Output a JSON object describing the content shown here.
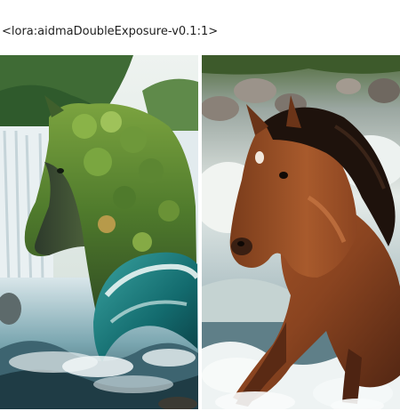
{
  "prompt_text": "<lora:aidmaDoubleExposure-v0.1:1>",
  "images": [
    {
      "subject": "horse-double-exposure-forest-waterfall"
    },
    {
      "subject": "brown-horse-running-in-river"
    }
  ],
  "colors": {
    "background": "#ffffff",
    "text": "#1f1f1f"
  }
}
